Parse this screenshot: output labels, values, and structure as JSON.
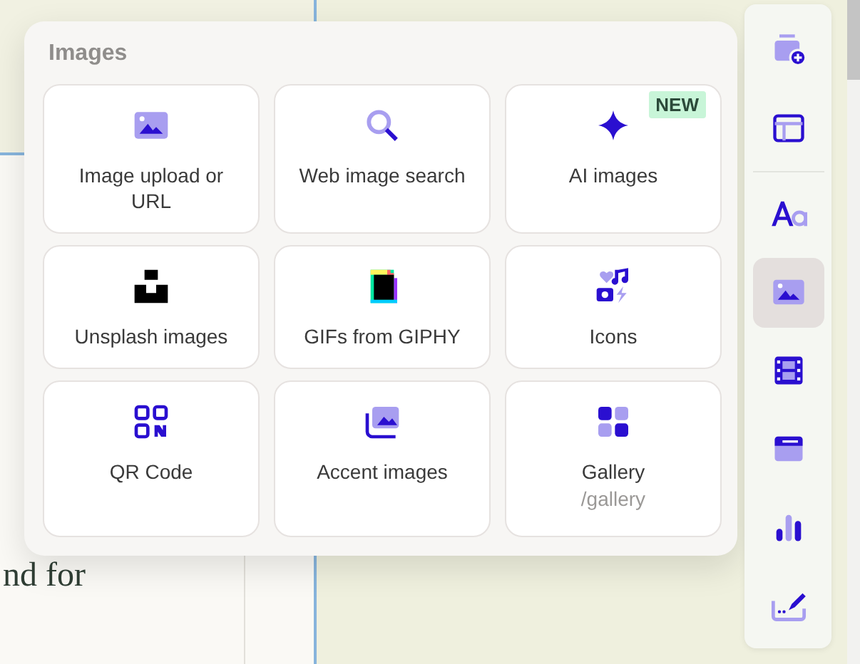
{
  "document": {
    "text": "nd for"
  },
  "panel": {
    "title": "Images",
    "cards": [
      {
        "label": "Image upload or URL"
      },
      {
        "label": "Web image search"
      },
      {
        "label": "AI images",
        "badge": "NEW"
      },
      {
        "label": "Unsplash images"
      },
      {
        "label": "GIFs from GIPHY"
      },
      {
        "label": "Icons"
      },
      {
        "label": "QR Code"
      },
      {
        "label": "Accent images"
      },
      {
        "label": "Gallery",
        "subtitle": "/gallery"
      }
    ]
  },
  "toolbar": {
    "items": [
      {
        "selected": false
      },
      {
        "selected": false
      },
      {
        "selected": false
      },
      {
        "selected": true
      },
      {
        "selected": false
      },
      {
        "selected": false
      },
      {
        "selected": false
      },
      {
        "selected": false
      }
    ]
  }
}
